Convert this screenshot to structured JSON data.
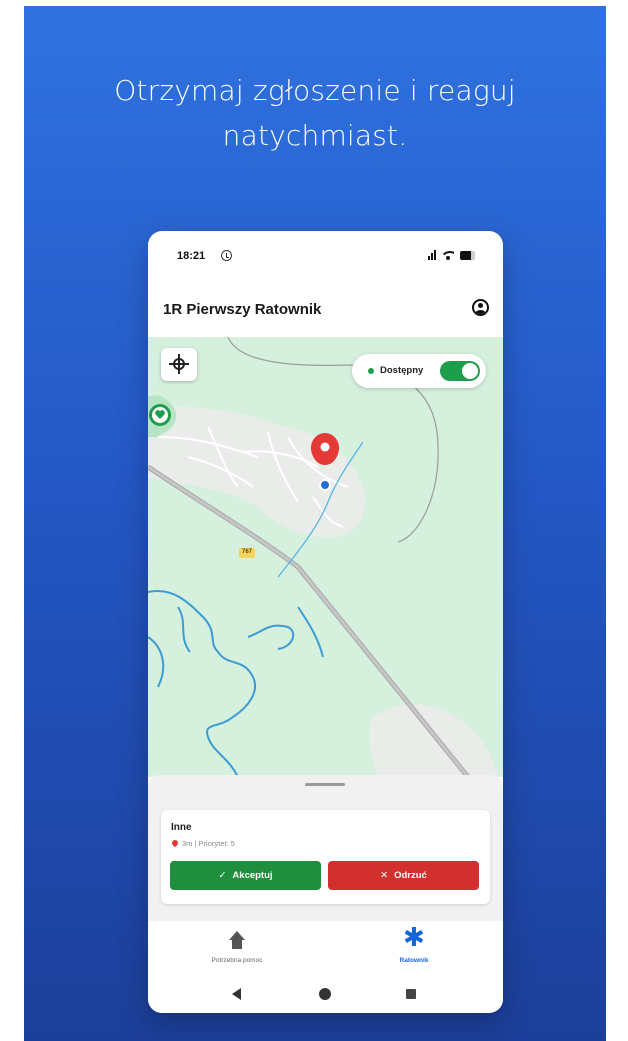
{
  "headline": {
    "line1": "Otrzymaj zgłoszenie i reaguj",
    "line2": "natychmiast."
  },
  "status_bar": {
    "time": "18:21",
    "icons": [
      "alarm-icon",
      "signal-icon",
      "wifi-icon",
      "battery-icon"
    ]
  },
  "app_bar": {
    "title": "1R Pierwszy Ratownik",
    "profile_icon": "account-circle-icon"
  },
  "map": {
    "road_label": "767",
    "availability": {
      "label": "Dostępny",
      "enabled": true
    },
    "colors": {
      "land": "#d6f0de",
      "urban": "#e9ece8",
      "water": "#3d9bd4",
      "pin": "#e53935",
      "user_location": "#1e6fd9"
    }
  },
  "incident_card": {
    "title": "Inne",
    "meta": "3m | Priorytet: 5",
    "accept_label": "Akceptuj",
    "reject_label": "Odrzuć",
    "accept_icon": "✓",
    "reject_icon": "✕"
  },
  "bottom_nav": {
    "items": [
      {
        "label": "Potrzebna pomoc",
        "icon": "home-icon",
        "active": false
      },
      {
        "label": "Ratownik",
        "icon": "asterisk-icon",
        "active": true
      }
    ]
  },
  "colors": {
    "background_top": "#2f72df",
    "background_bottom": "#1c3f9a",
    "accept": "#1f8e3d",
    "reject": "#d22f2f",
    "active_nav": "#1565d8"
  }
}
